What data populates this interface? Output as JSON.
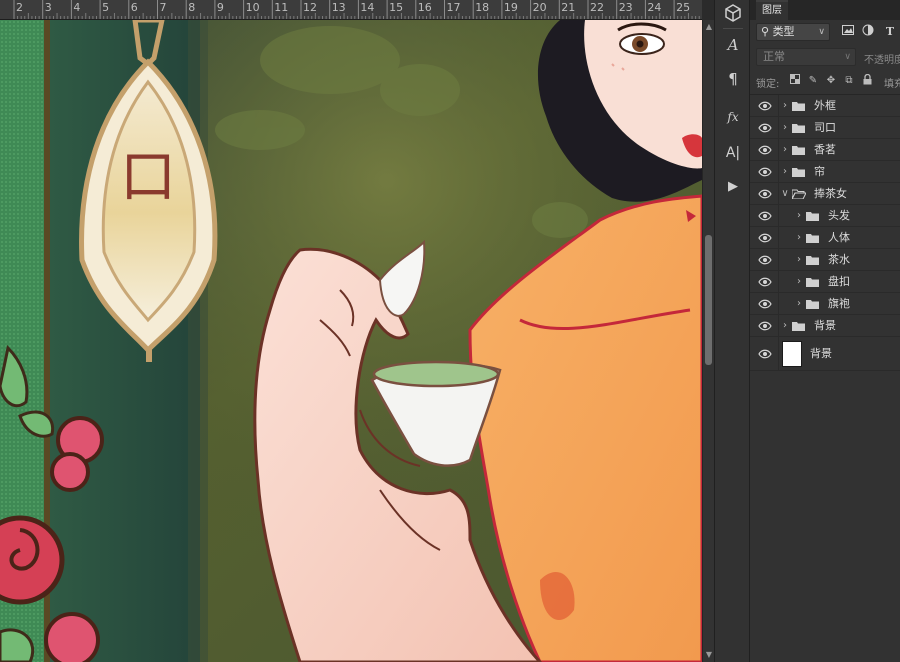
{
  "ruler": {
    "labels": [
      "2",
      "3",
      "4",
      "5",
      "6",
      "7",
      "8",
      "9",
      "10",
      "11",
      "12",
      "13",
      "14",
      "15",
      "16",
      "17",
      "18",
      "19",
      "20",
      "21",
      "22",
      "23",
      "24",
      "25"
    ]
  },
  "canvas": {
    "plaque_text": "口",
    "colors": {
      "background": "#4f5a34",
      "door_green": "#2e4f41",
      "plaque_gold": "#c9a877",
      "dress_orange": "#f4a65d",
      "skin": "#f7cfc1",
      "outline": "#5b2f22",
      "hair": "#1d1b22",
      "flower_red": "#d9445a",
      "leaf_green": "#6cb36f"
    }
  },
  "toolbar": {
    "tools": [
      {
        "icon": "3d-cube-icon",
        "glyph": "⬢"
      },
      {
        "icon": "character-icon",
        "glyph": "A"
      },
      {
        "icon": "paragraph-icon",
        "glyph": "¶"
      },
      {
        "icon": "fx-icon",
        "glyph": "fx"
      },
      {
        "icon": "glyph-panel-icon",
        "glyph": "A|"
      },
      {
        "icon": "play-action-icon",
        "glyph": "▶"
      }
    ]
  },
  "layers_panel": {
    "tab_label": "图层",
    "filter_label": "类型",
    "blend_mode": "正常",
    "opacity_label": "不透明度",
    "lock_label": "锁定:",
    "fill_label": "填充",
    "layers": [
      {
        "name": "外框",
        "type": "group",
        "expanded": false,
        "indent": 0
      },
      {
        "name": "司口",
        "type": "group",
        "expanded": false,
        "indent": 0
      },
      {
        "name": "香茗",
        "type": "group",
        "expanded": false,
        "indent": 0
      },
      {
        "name": "帘",
        "type": "group",
        "expanded": false,
        "indent": 0
      },
      {
        "name": "捧茶女",
        "type": "group",
        "expanded": true,
        "indent": 0
      },
      {
        "name": "头发",
        "type": "group",
        "expanded": false,
        "indent": 1
      },
      {
        "name": "人体",
        "type": "group",
        "expanded": false,
        "indent": 1
      },
      {
        "name": "茶水",
        "type": "group",
        "expanded": false,
        "indent": 1
      },
      {
        "name": "盘扣",
        "type": "group",
        "expanded": false,
        "indent": 1
      },
      {
        "name": "旗袍",
        "type": "group",
        "expanded": false,
        "indent": 1
      },
      {
        "name": "背景",
        "type": "group",
        "expanded": false,
        "indent": 0
      },
      {
        "name": "背景",
        "type": "layer",
        "expanded": false,
        "indent": 0
      }
    ]
  }
}
